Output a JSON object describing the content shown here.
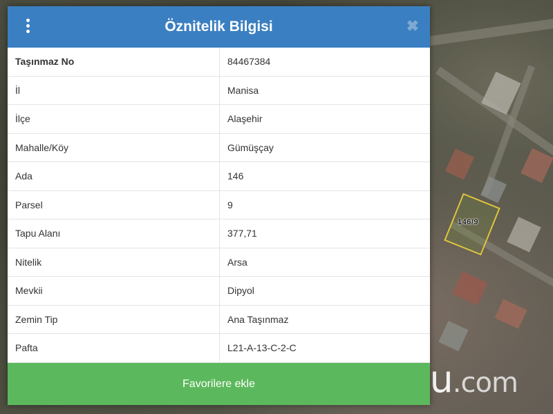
{
  "panel": {
    "title": "Öznitelik Bilgisi",
    "menu_icon": "more-vertical-icon",
    "close_icon": "close-icon",
    "close_symbol": "✖",
    "rows": [
      {
        "key": "Taşınmaz No",
        "value": "84467384"
      },
      {
        "key": "İl",
        "value": "Manisa"
      },
      {
        "key": "İlçe",
        "value": "Alaşehir"
      },
      {
        "key": "Mahalle/Köy",
        "value": "Gümüşçay"
      },
      {
        "key": "Ada",
        "value": "146"
      },
      {
        "key": "Parsel",
        "value": "9"
      },
      {
        "key": "Tapu Alanı",
        "value": "377,71"
      },
      {
        "key": "Nitelik",
        "value": "Arsa"
      },
      {
        "key": "Mevkii",
        "value": "Dipyol"
      },
      {
        "key": "Zemin Tip",
        "value": "Ana Taşınmaz"
      },
      {
        "key": "Pafta",
        "value": "L21-A-13-C-2-C"
      }
    ],
    "favorite_button": "Favorilere ekle"
  },
  "map": {
    "parcel_label": "146/9"
  },
  "watermark": {
    "brand": "tapu",
    "suffix": ".com"
  },
  "colors": {
    "header": "#3a7fc1",
    "favorite_button": "#5cb85c",
    "parcel_outline": "#e0c63c"
  }
}
